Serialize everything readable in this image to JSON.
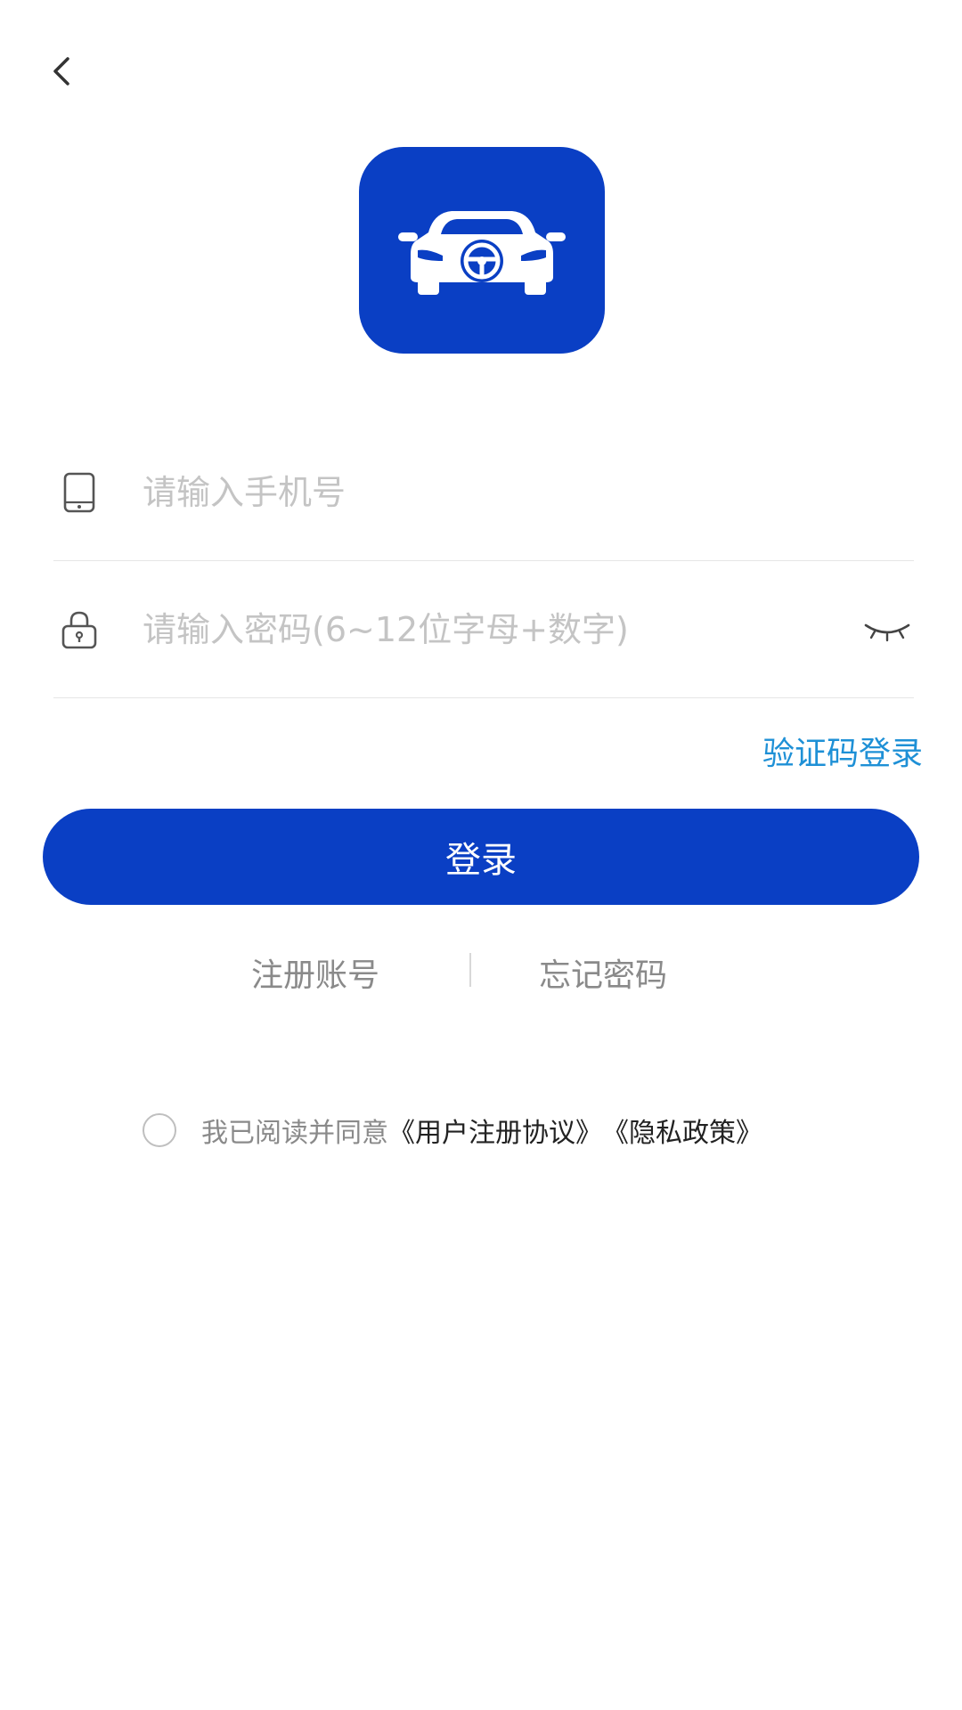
{
  "header": {
    "back_icon": "chevron-left-icon"
  },
  "logo": {
    "icon": "car-steering-wheel-icon",
    "background": "#0a3fc4"
  },
  "form": {
    "phone": {
      "icon": "phone-icon",
      "placeholder": "请输入手机号",
      "value": ""
    },
    "password": {
      "icon": "lock-icon",
      "placeholder": "请输入密码(6~12位字母+数字)",
      "value": "",
      "toggle_icon": "eye-closed-icon"
    }
  },
  "sms_login_label": "验证码登录",
  "login_button_label": "登录",
  "links": {
    "register": "注册账号",
    "forgot_password": "忘记密码"
  },
  "agreement": {
    "prefix": "我已阅读并同意",
    "user_agreement": "《用户注册协议》",
    "privacy_policy": "《隐私政策》",
    "checked": false
  },
  "colors": {
    "primary": "#0a3fc4",
    "link": "#1e90d6",
    "muted_text": "#8a8a8a",
    "placeholder": "#c4c4c4"
  }
}
